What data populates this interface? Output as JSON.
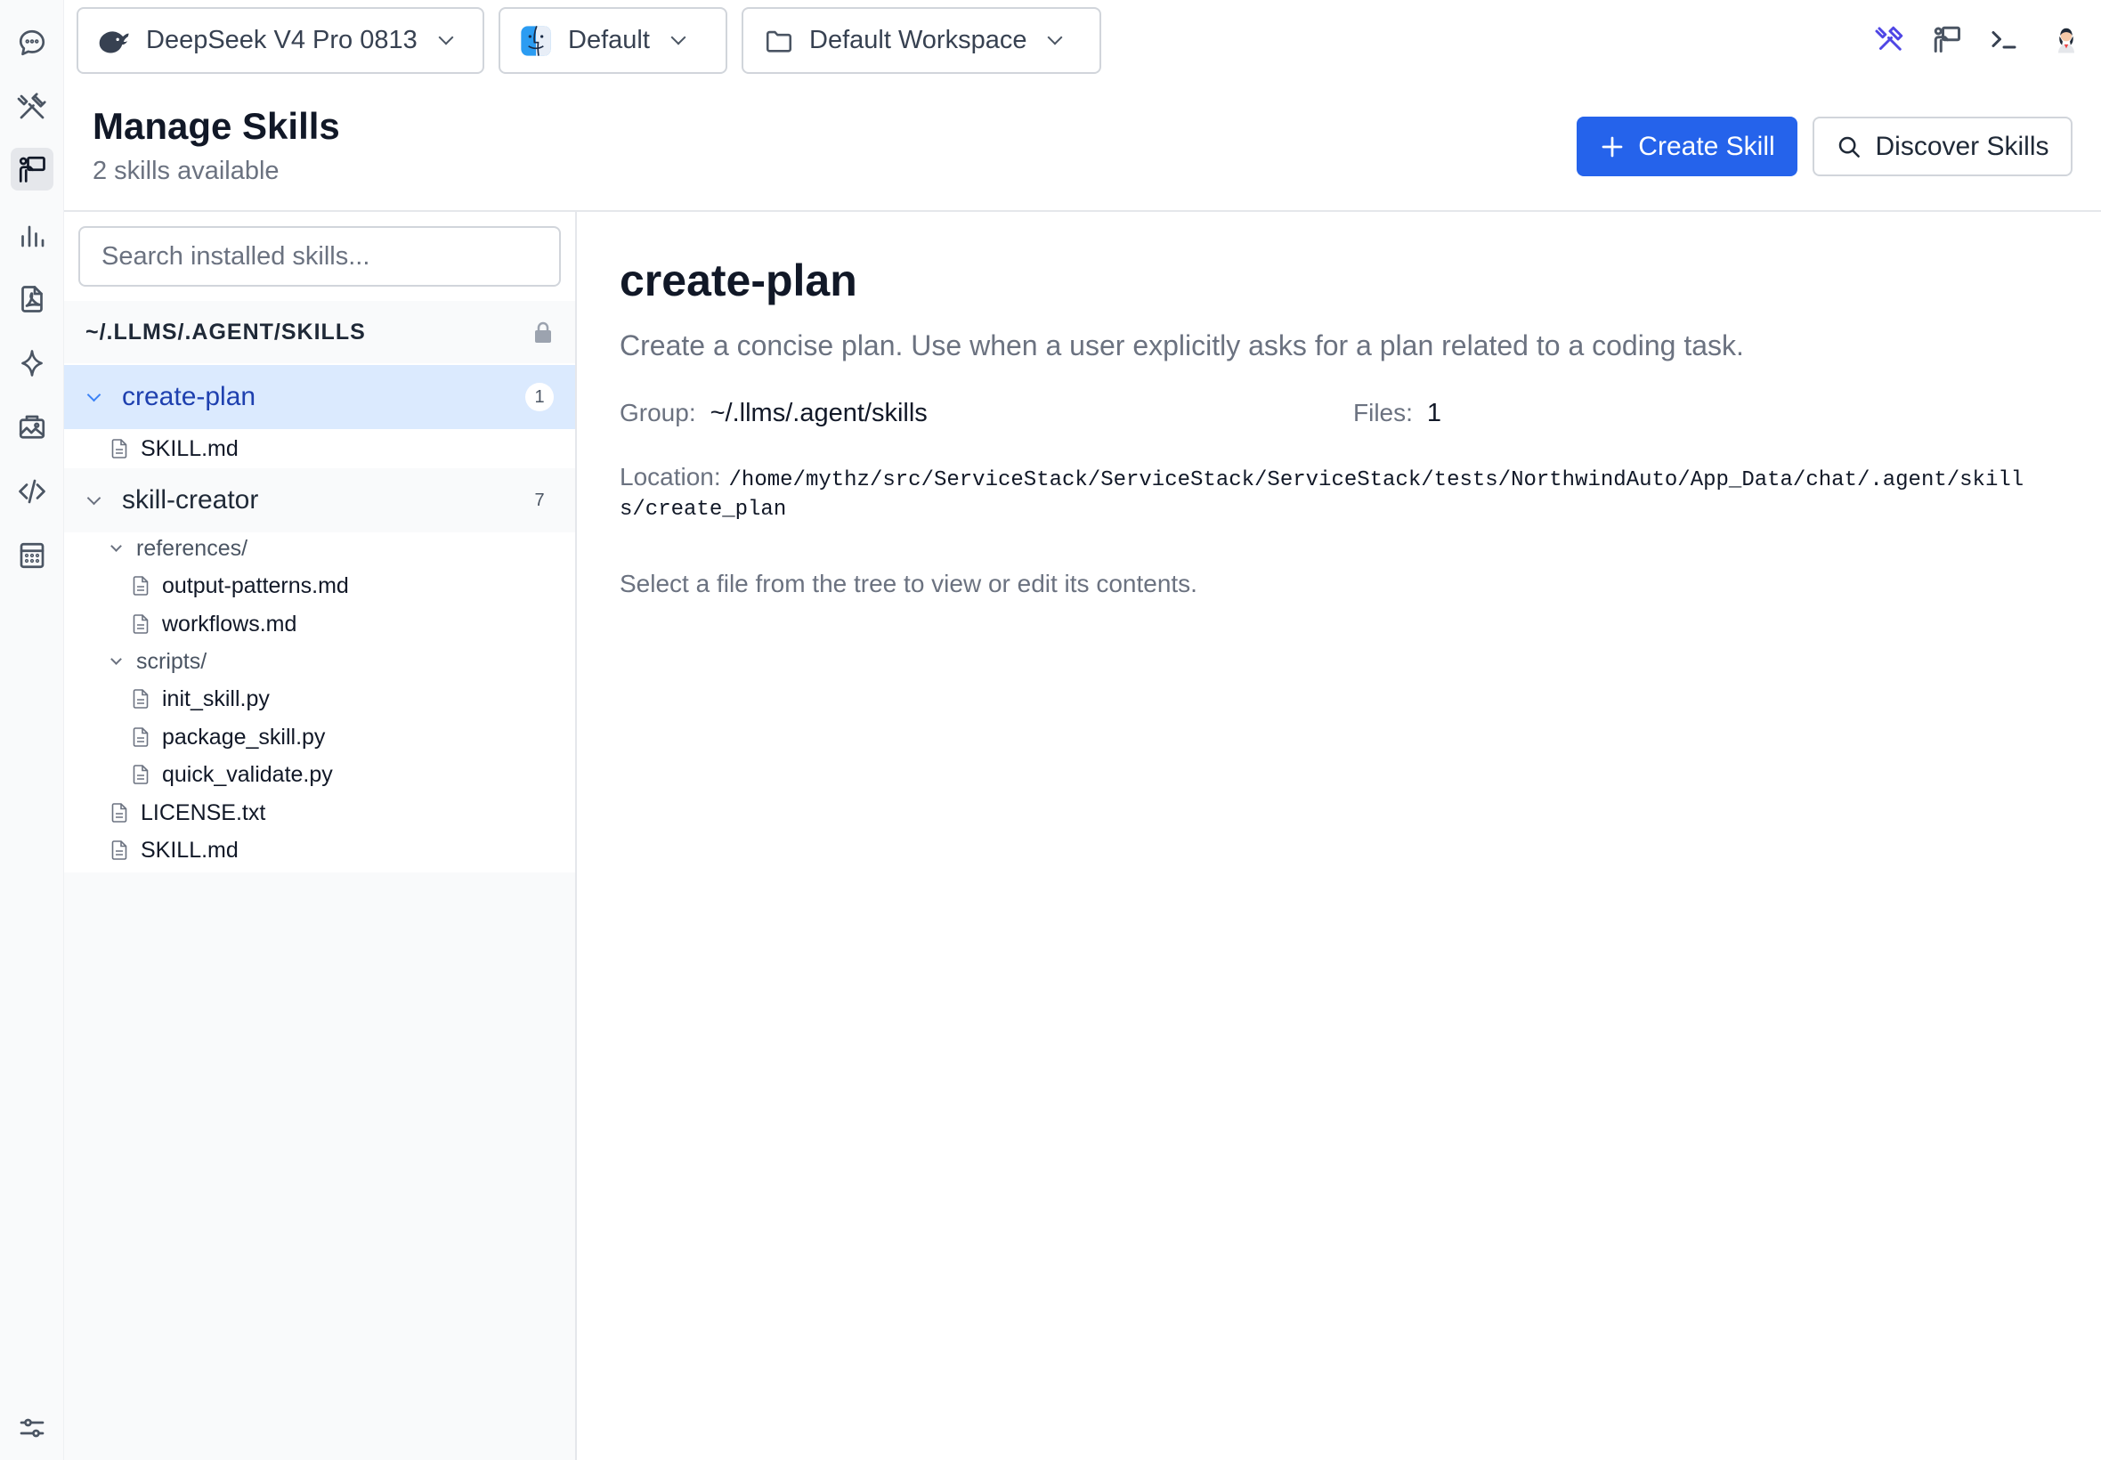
{
  "topbar": {
    "model": "DeepSeek V4 Pro 0813",
    "profile": "Default",
    "workspace": "Default Workspace"
  },
  "header": {
    "title": "Manage Skills",
    "subtitle": "2 skills available",
    "create_label": "Create Skill",
    "discover_label": "Discover Skills"
  },
  "sidebar": {
    "search_placeholder": "Search installed skills...",
    "group": "~/.LLMS/.AGENT/SKILLS",
    "skills": [
      {
        "name": "create-plan",
        "count": "1",
        "files": [
          "SKILL.md"
        ]
      },
      {
        "name": "skill-creator",
        "count": "7"
      }
    ],
    "skill_creator_tree": {
      "references": "references/",
      "ref_files": [
        "output-patterns.md",
        "workflows.md"
      ],
      "scripts": "scripts/",
      "script_files": [
        "init_skill.py",
        "package_skill.py",
        "quick_validate.py"
      ],
      "root_files": [
        "LICENSE.txt",
        "SKILL.md"
      ]
    }
  },
  "detail": {
    "title": "create-plan",
    "description": "Create a concise plan. Use when a user explicitly asks for a plan related to a coding task.",
    "group_label": "Group:",
    "group_value": "~/.llms/.agent/skills",
    "files_label": "Files:",
    "files_value": "1",
    "location_label": "Location:",
    "location_value": "/home/mythz/src/ServiceStack/ServiceStack/ServiceStack/tests/NorthwindAuto/App_Data/chat/.agent/skills/create_plan",
    "hint": "Select a file from the tree to view or edit its contents."
  },
  "colors": {
    "accent": "#2563eb",
    "selected_bg": "#dbeafe",
    "selected_text": "#1e40af"
  }
}
